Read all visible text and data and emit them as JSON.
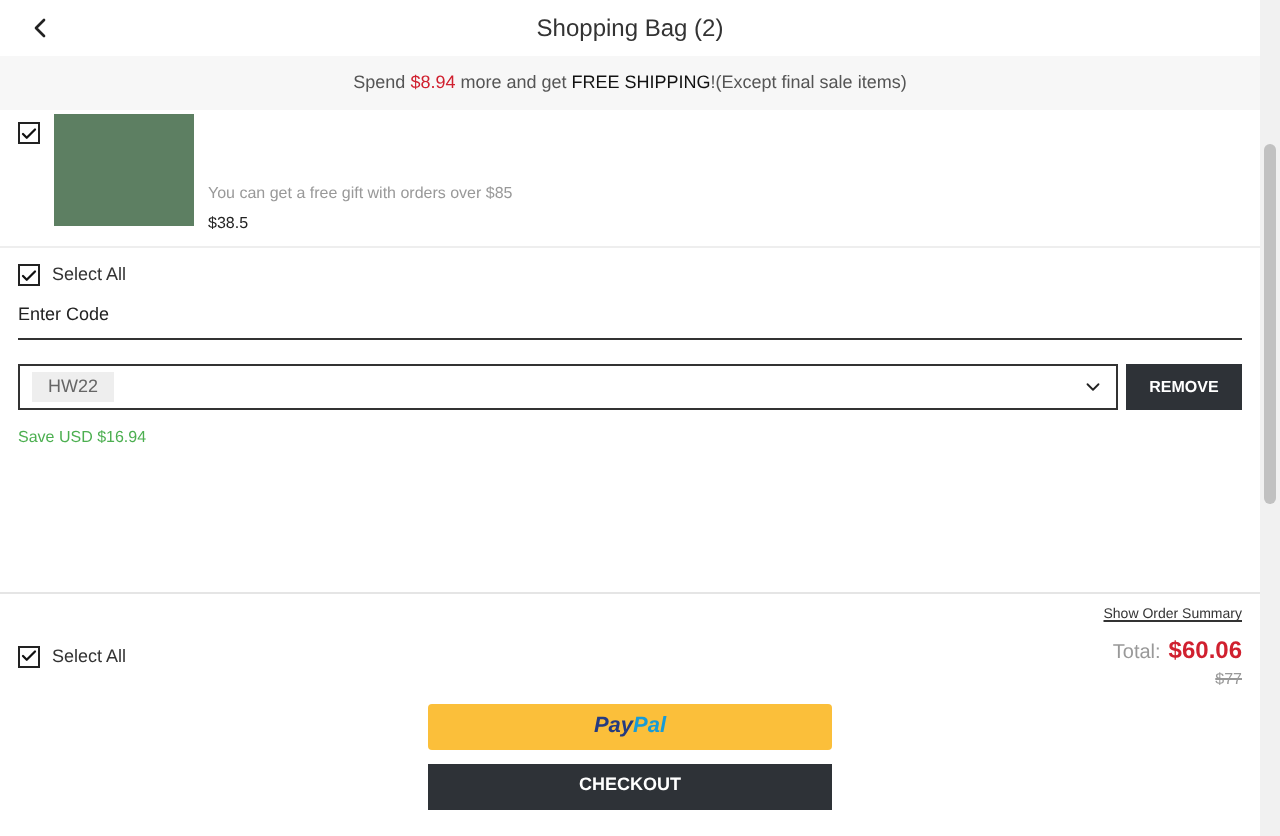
{
  "header": {
    "title": "Shopping Bag (2)"
  },
  "banner": {
    "segments": [
      {
        "kind": "plain",
        "text": "Spend "
      },
      {
        "kind": "amount",
        "text": "$8.94"
      },
      {
        "kind": "plain",
        "text": " more and get "
      },
      {
        "kind": "strong",
        "text": "FREE SHIPPING"
      },
      {
        "kind": "plain",
        "text": "!(Except final sale items)"
      }
    ]
  },
  "item": {
    "checked": true,
    "gift_note": "You can get a free gift with orders over $85",
    "price": "$38.5"
  },
  "select_all_top": {
    "label": "Select All",
    "checked": true
  },
  "coupon": {
    "label": "Enter Code",
    "code": "HW22",
    "button": "REMOVE",
    "saving": "Save USD $16.94"
  },
  "footer": {
    "select_all": {
      "label": "Select All",
      "checked": true
    },
    "summary_link": "Show Order Summary",
    "total_label": "Total:",
    "total": "$60.06",
    "original_price": "$77",
    "paypal": [
      "Pay",
      "Pal"
    ],
    "checkout": "CHECKOUT"
  }
}
